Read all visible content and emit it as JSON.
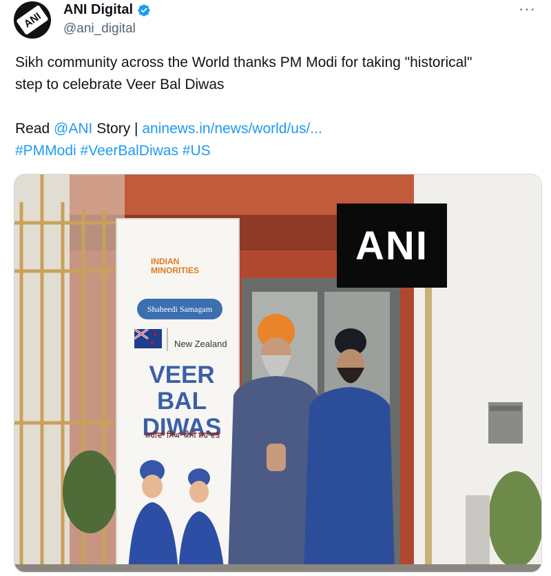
{
  "author": {
    "display_name": "ANI Digital",
    "handle": "@ani_digital",
    "avatar_text": "ANI",
    "verified_icon": "verified-badge-icon",
    "verified_color": "#1d9bf0"
  },
  "menu": {
    "more_label": "···"
  },
  "tweet": {
    "line1": "Sikh community across the World thanks PM Modi for taking \"historical\"",
    "line2": "step to celebrate Veer Bal Diwas",
    "read_prefix": "Read ",
    "mention": "@ANI",
    "story_text": " Story | ",
    "link": "aninews.in/news/world/us/...",
    "hashtags": [
      "#PMModi",
      "#VeerBalDiwas",
      "#US"
    ]
  },
  "media": {
    "watermark": "ANI",
    "banner": {
      "org_line1": "INDIAN",
      "org_line2": "MINORITIES",
      "pill": "Shaheedi Samagam",
      "country": "New Zealand",
      "title_line1": "VEER BAL",
      "title_line2": "DIWAS",
      "subtitle": "ਸ਼ਹੀਦਾਂ ਸਿੰਘਾਂ ਕੌਮੀ ਸ਼ਹਾਦਤ"
    }
  },
  "colors": {
    "link": "#1d9bf0",
    "text": "#0f1419",
    "secondary": "#536471"
  }
}
